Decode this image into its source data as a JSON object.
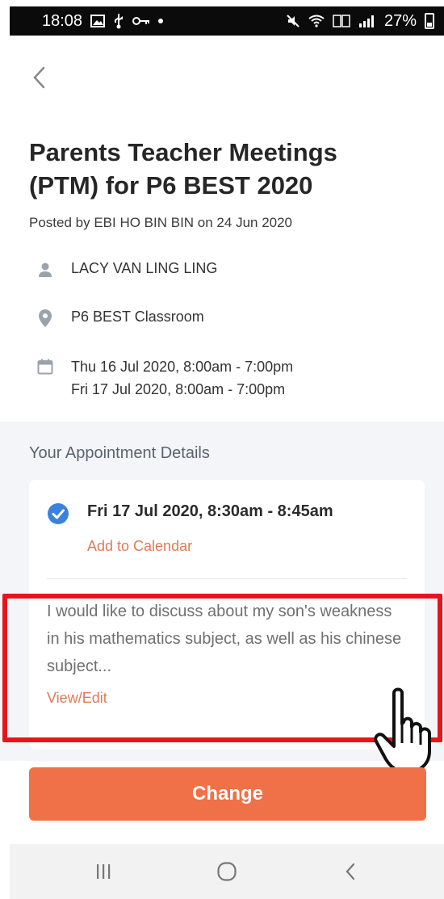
{
  "status_bar": {
    "time": "18:08",
    "battery": "27%",
    "icons": [
      "gallery-icon",
      "usb-icon",
      "key-icon",
      "dot-icon",
      "mute-icon",
      "wifi-icon",
      "volte-icon",
      "signal-icon",
      "battery-icon"
    ]
  },
  "header": {
    "title": "Parents Teacher Meetings (PTM) for P6 BEST 2020",
    "posted_by": "Posted by EBI HO BIN BIN on 24 Jun 2020"
  },
  "info": {
    "person": "LACY VAN LING LING",
    "location": "P6 BEST Classroom",
    "dates": [
      "Thu 16 Jul 2020, 8:00am - 7:00pm",
      "Fri 17 Jul 2020, 8:00am - 7:00pm"
    ]
  },
  "appointment": {
    "heading": "Your Appointment Details",
    "slot": "Fri 17 Jul 2020, 8:30am - 8:45am",
    "add_to_calendar": "Add to Calendar",
    "note": "I would like to discuss about my son's weakness in his mathematics subject, as well as his chinese subject...",
    "view_edit": "View/Edit"
  },
  "actions": {
    "change": "Change"
  },
  "colors": {
    "accent": "#f07048",
    "link": "#e07a55",
    "check": "#3b82e0",
    "highlight": "#e8141c",
    "section_bg": "#f3f5f8"
  }
}
